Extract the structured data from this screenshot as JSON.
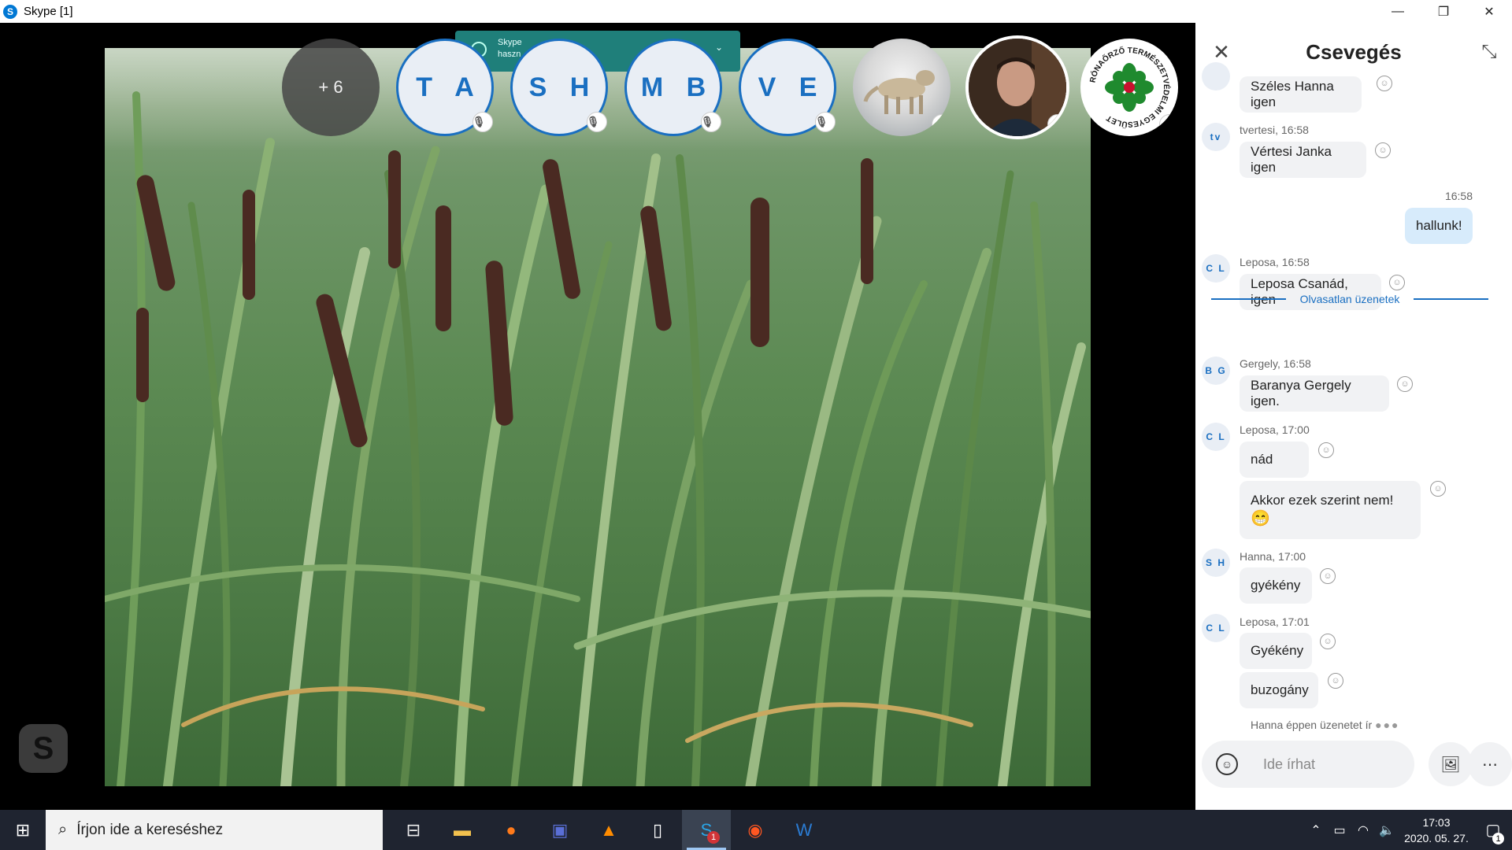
{
  "window": {
    "title": "Skype [1]",
    "app_icon": "skype-icon",
    "buttons": [
      "minimize",
      "restore",
      "close"
    ]
  },
  "call": {
    "notification": {
      "line1": "Skype",
      "line2": "haszn"
    },
    "more_participants": "+ 6",
    "participants": [
      {
        "initials": "T A",
        "muted": true
      },
      {
        "initials": "S H",
        "muted": true
      },
      {
        "initials": "M B",
        "muted": true
      },
      {
        "initials": "V E",
        "muted": true
      }
    ],
    "logo_text": "RÓNAŐRZŐ TERMÉSZETVÉDELMI EGYESÜLET",
    "accent_color": "#1a6fc1"
  },
  "chat": {
    "title": "Csevegés",
    "messages": [
      {
        "initials": "",
        "meta": "",
        "text": "Széles Hanna igen"
      },
      {
        "initials": "tv",
        "meta": "tvertesi, 16:58",
        "text": "Vértesi Janka igen"
      },
      {
        "own": true,
        "meta": "16:58",
        "text": "hallunk!"
      },
      {
        "initials": "C L",
        "meta": "Leposa, 16:58",
        "text": "Leposa Csanád, igen"
      },
      {
        "initials": "B G",
        "meta": "Gergely, 16:58",
        "text": "Baranya Gergely igen."
      },
      {
        "initials": "C L",
        "meta": "Leposa, 17:00",
        "text": "nád"
      },
      {
        "initials": "",
        "meta": "",
        "text": "Akkor ezek szerint nem!",
        "emoji": "😁"
      },
      {
        "initials": "S H",
        "meta": "Hanna, 17:00",
        "text": "gyékény"
      },
      {
        "initials": "C L",
        "meta": "Leposa, 17:01",
        "text": "Gyékény"
      },
      {
        "initials": "",
        "meta": "",
        "text": "buzogány"
      }
    ],
    "unread_label": "Olvasatlan üzenetek",
    "typing": "Hanna éppen üzenetet ír",
    "composer_placeholder": "Ide írhat"
  },
  "taskbar": {
    "search_placeholder": "Írjon ide a kereséshez",
    "skype_badge": "1",
    "time": "17:03",
    "date": "2020. 05. 27.",
    "notification_count": "1"
  }
}
